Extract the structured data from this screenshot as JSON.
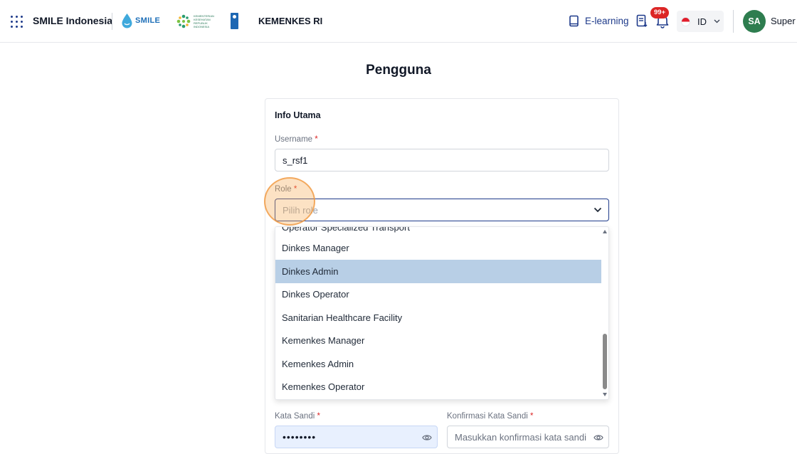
{
  "header": {
    "brand": "SMILE Indonesia",
    "smile_logo_text": "SMILE",
    "kemenkes_logo_text": "KEMENTERIAN KESEHATAN REPUBLIK INDONESIA",
    "org": "KEMENKES RI",
    "elearning_label": "E-learning",
    "notification_count": "99+",
    "language_code": "ID",
    "avatar_initials": "SA",
    "user_name": "Super Admin"
  },
  "page": {
    "title": "Pengguna"
  },
  "form": {
    "section_title": "Info Utama",
    "required_mark": "*",
    "username_label": "Username",
    "username_value": "s_rsf1",
    "role_label": "Role",
    "role_placeholder": "Pilih role",
    "password_label": "Kata Sandi",
    "password_value": "••••••••",
    "confirm_label": "Konfirmasi Kata Sandi",
    "confirm_placeholder": "Masukkan konfirmasi kata sandi"
  },
  "role_options": [
    "Operator Specialized Transport",
    "Dinkes Manager",
    "Dinkes Admin",
    "Dinkes Operator",
    "Sanitarian Healthcare Facility",
    "Kemenkes Manager",
    "Kemenkes Admin",
    "Kemenkes Operator"
  ],
  "highlighted_option": "Dinkes Admin",
  "colors": {
    "primary": "#1e3a8a",
    "highlight": "#b8cfe6",
    "badge": "#dc2626",
    "avatar": "#2e7d4f",
    "click_indicator": "#f6ad55"
  }
}
